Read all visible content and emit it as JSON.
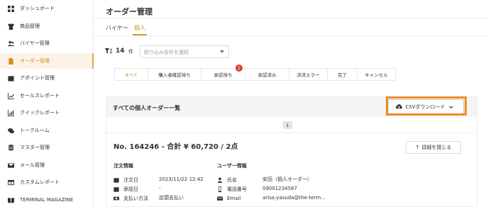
{
  "sidebar": {
    "items": [
      {
        "label": "ダッシュボード",
        "icon": "dashboard-icon"
      },
      {
        "label": "商品管理",
        "icon": "shirt-icon"
      },
      {
        "label": "バイヤー管理",
        "icon": "users-icon"
      },
      {
        "label": "オーダー管理",
        "icon": "document-icon",
        "active": true
      },
      {
        "label": "アポイント管理",
        "icon": "calendar-icon"
      },
      {
        "label": "セールスレポート",
        "icon": "chart-line-icon"
      },
      {
        "label": "クイックレポート",
        "icon": "chart-bar-icon"
      },
      {
        "label": "トークルーム",
        "icon": "chat-icon"
      },
      {
        "label": "マスター管理",
        "icon": "database-icon"
      },
      {
        "label": "メール管理",
        "icon": "mail-icon"
      },
      {
        "label": "カスタムレポート",
        "icon": "table-icon"
      },
      {
        "label": "TERMINAL MAGAZINE",
        "icon": "book-icon"
      }
    ]
  },
  "header": {
    "title": "オーダー管理",
    "tabs": [
      "バイヤー",
      "個人"
    ]
  },
  "filter": {
    "count": "14",
    "unit": "件",
    "placeholder": "絞り込み条件を選択"
  },
  "status_tabs": [
    {
      "label": "すべて"
    },
    {
      "label": "購入者確認待ち"
    },
    {
      "label": "承認待ち",
      "badge": "1"
    },
    {
      "label": "承認済み"
    },
    {
      "label": "決済エラー"
    },
    {
      "label": "完了"
    },
    {
      "label": "キャンセル"
    }
  ],
  "card": {
    "title": "すべての個人オーダー一覧",
    "csv_label": "CSVダウンロード",
    "page": "1"
  },
  "order": {
    "title": "No. 164246 - 合計 ¥ 60,720 / 2点",
    "close_label": "詳細を閉じる",
    "order_info_title": "注文情報",
    "user_info_title": "ユーザー情報",
    "order_rows": [
      {
        "label": "注文日",
        "value": "2023/11/22 12:42",
        "icon": "calendar-icon"
      },
      {
        "label": "承認日",
        "value": "-",
        "icon": "calendar-check-icon"
      },
      {
        "label": "支払い方法",
        "value": "店頭支払い",
        "icon": "money-icon"
      }
    ],
    "user_rows": [
      {
        "label": "氏名",
        "value": "安田（個人オーダー）",
        "icon": "person-icon"
      },
      {
        "label": "電話番号",
        "value": "09001234567",
        "icon": "phone-icon"
      },
      {
        "label": "Email",
        "value": "arisa.yasuda@the-term…",
        "icon": "mail-icon"
      }
    ]
  },
  "colors": {
    "accent": "#d98a1b",
    "highlight": "#ef8c25",
    "badge": "#d9413a"
  }
}
